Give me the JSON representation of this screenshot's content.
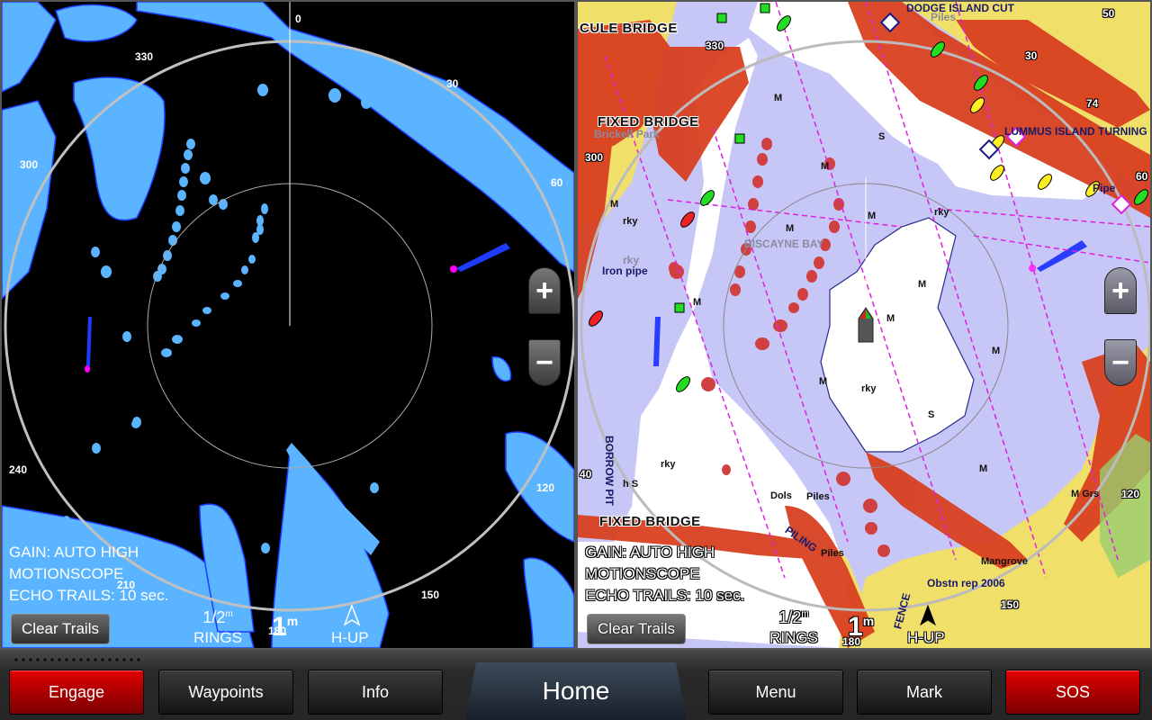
{
  "radar_pane": {
    "status_lines": [
      "GAIN: AUTO HIGH",
      "MOTIONSCOPE",
      "ECHO TRAILS: 10 sec."
    ],
    "clear_trails_label": "Clear Trails",
    "rings_value": "1/2",
    "rings_unit": "m",
    "rings_label": "RINGS",
    "range_value": "1",
    "range_unit": "m",
    "orientation_label": "H-UP",
    "zoom_in_label": "+",
    "zoom_out_label": "−",
    "bearings": [
      "0",
      "30",
      "60",
      "120",
      "150",
      "180",
      "210",
      "240",
      "300",
      "330"
    ],
    "colors": {
      "background": "#000000",
      "echo": "#5ab4ff",
      "echo_dark": "#1e3cff",
      "target": "#ff00ff"
    }
  },
  "chart_pane": {
    "status_lines": [
      "GAIN: AUTO HIGH",
      "MOTIONSCOPE",
      "ECHO TRAILS: 10 sec."
    ],
    "clear_trails_label": "Clear Trails",
    "rings_value": "1/2",
    "rings_unit": "m",
    "rings_label": "RINGS",
    "range_value": "1",
    "range_unit": "m",
    "orientation_label": "H-UP",
    "zoom_in_label": "+",
    "zoom_out_label": "−",
    "bearings": [
      "30",
      "60",
      "120",
      "150",
      "180",
      "300",
      "330",
      "40",
      "50",
      "74"
    ],
    "labels": {
      "cule_bridge": "CULE BRIDGE",
      "fixed_bridge_top": "FIXED BRIDGE",
      "brickell_park": "Brickell Park",
      "dodge_island_cut": "DODGE ISLAND CUT",
      "piles_top": "Piles",
      "lummus": "LUMMUS ISLAND TURNING",
      "pipe": "Pipe",
      "biscayne_bay": "BISCAYNE BAY",
      "iron_pipe": "Iron pipe",
      "rky1": "rky",
      "rky2": "rky",
      "rky3": "rky",
      "rky4": "rky",
      "rky5": "rky",
      "borrow_pit": "BORROW PIT",
      "hs": "h S",
      "fixed_bridge_bottom": "FIXED BRIDGE",
      "dols": "Dols",
      "piles1": "Piles",
      "piles2": "Piles",
      "piling": "PILING",
      "mangrove": "Mangrove",
      "obstn": "Obstn rep 2006",
      "fence": "FENCE",
      "m_grs": "M Grs",
      "m": "M",
      "s": "S"
    },
    "colors": {
      "water": "#c6c6f7",
      "shallow": "#ffffff",
      "land": "#f0e06a",
      "radar_overlay": "#d84020",
      "green_land": "#9acd70"
    }
  },
  "bottom_bar": {
    "buttons": [
      {
        "label": "Engage",
        "style": "red"
      },
      {
        "label": "Waypoints",
        "style": "dark"
      },
      {
        "label": "Info",
        "style": "dark"
      },
      {
        "label": "Menu",
        "style": "dark"
      },
      {
        "label": "Mark",
        "style": "dark"
      },
      {
        "label": "SOS",
        "style": "red"
      }
    ],
    "home_label": "Home"
  }
}
